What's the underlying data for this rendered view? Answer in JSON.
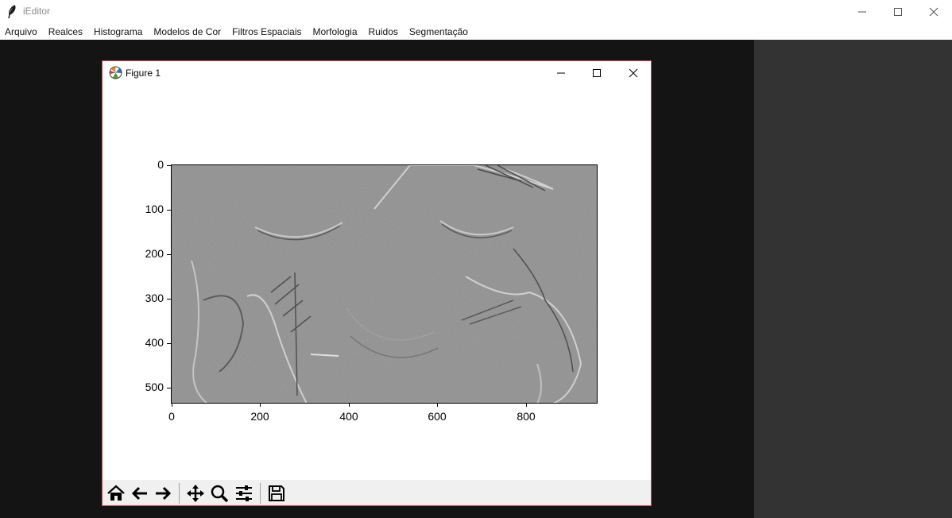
{
  "window": {
    "title": "iEditor",
    "icons": {
      "app": "feather-icon",
      "minimize": "minimize-icon",
      "maximize": "maximize-icon",
      "close": "close-icon"
    }
  },
  "menubar": {
    "items": [
      "Arquivo",
      "Realces",
      "Histograma",
      "Modelos de Cor",
      "Filtros Espaciais",
      "Morfologia",
      "Ruidos",
      "Segmentação"
    ]
  },
  "figure": {
    "title": "Figure 1",
    "icons": {
      "app": "matplotlib-icon",
      "minimize": "minimize-icon",
      "maximize": "maximize-icon",
      "close": "close-icon"
    },
    "plot": {
      "image": "embossed-grayscale-image-hummingbirds",
      "y_ticks": [
        "0",
        "100",
        "200",
        "300",
        "400",
        "500"
      ],
      "x_ticks": [
        "0",
        "200",
        "400",
        "600",
        "800"
      ]
    },
    "toolbar": {
      "buttons": [
        "home-icon",
        "back-arrow-icon",
        "forward-arrow-icon",
        "pan-icon",
        "zoom-icon",
        "configure-subplots-icon",
        "save-icon"
      ]
    }
  },
  "colors": {
    "canvas": "#141414",
    "side_panel": "#333333",
    "figure_border": "#d04848",
    "toolbar": "#f0f0f0"
  }
}
